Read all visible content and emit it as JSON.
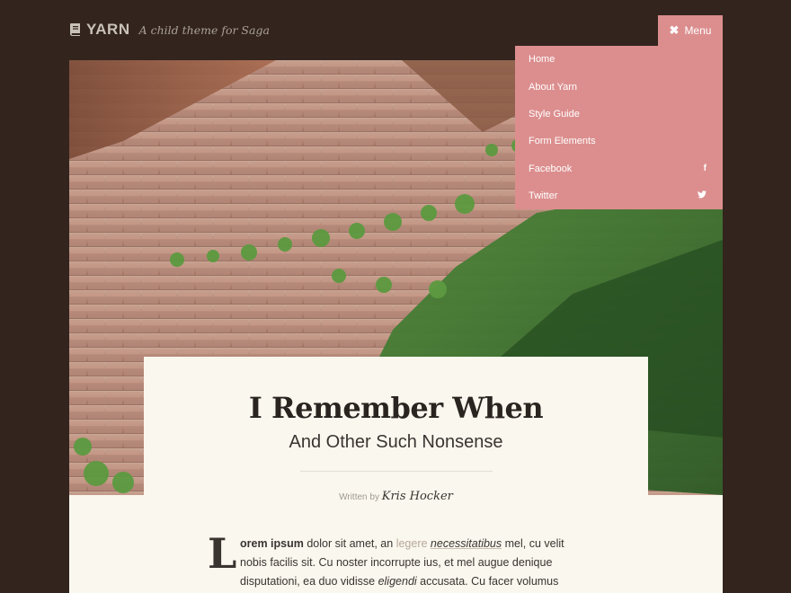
{
  "header": {
    "logo": "YARN",
    "tagline": "A child theme for Saga",
    "icon": "book-icon"
  },
  "menu": {
    "toggle_icon": "close-icon",
    "toggle_label": "Menu",
    "items": [
      {
        "label": "Home"
      },
      {
        "label": "About Yarn"
      },
      {
        "label": "Style Guide"
      },
      {
        "label": "Form Elements"
      },
      {
        "label": "Facebook",
        "icon": "facebook-icon",
        "glyph": "f"
      },
      {
        "label": "Twitter",
        "icon": "twitter-icon",
        "glyph": "🐦"
      }
    ],
    "color": "#dc8e8e"
  },
  "post": {
    "title": "I Remember When",
    "subtitle": "And Other Such Nonsense",
    "byline_prefix": "Written by",
    "author": "Kris Hocker",
    "dropcap": "L",
    "body": {
      "lead_bold": "orem ipsum",
      "text1": " dolor sit amet, an ",
      "link": "legere",
      "space": " ",
      "italic_underlined": "necessitatibus",
      "text2": " mel, cu velit nobis facilis sit. Cu noster incorrupte ius, et mel augue denique disputationi, ea duo vidisse ",
      "italic": "eligendi",
      "text3": " accusata. Cu facer volumus"
    }
  },
  "colors": {
    "background": "#33241e",
    "paper": "#f9f7ee",
    "accent": "#dc8e8e"
  }
}
